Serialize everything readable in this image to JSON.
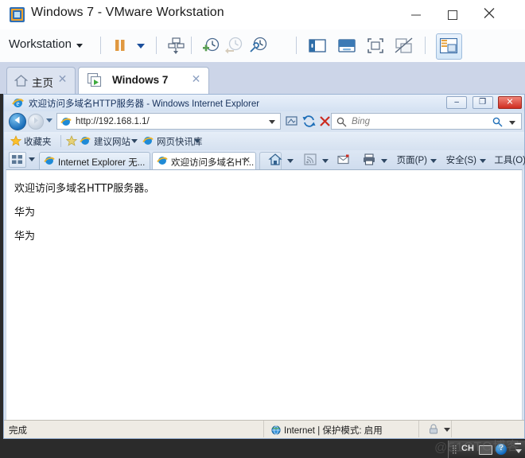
{
  "vmware": {
    "title": "Windows 7 - VMware Workstation",
    "title_icon": "vmware-app-icon",
    "window_controls": {
      "minimize": "—",
      "maximize": "□",
      "close": "✕"
    },
    "toolbar": {
      "menu_label": "Workstation",
      "icons": [
        "pause-vm-icon",
        "pause-dropdown-caret",
        "manage-snapshot-icon",
        "take-snapshot-icon",
        "revert-snapshot-icon",
        "snapshot-manager-icon",
        "show-sidebar-icon",
        "show-console-icon",
        "full-screen-icon",
        "unity-mode-icon",
        "show-thumbnail-bar-icon"
      ]
    },
    "tabs": [
      {
        "label": "主页",
        "icon": "home-icon",
        "close": "✕",
        "active": false
      },
      {
        "label": "Windows 7",
        "icon": "vm-running-icon",
        "close": "✕",
        "active": true
      }
    ]
  },
  "ie": {
    "title": "欢迎访问多域名HTTP服务器 - Windows Internet Explorer",
    "favicon": "ie-logo-icon",
    "window_controls": {
      "minimize": "–",
      "restore": "❐",
      "close": "✕"
    },
    "nav": {
      "back": "back-arrow-icon",
      "forward": "forward-arrow-icon",
      "history_caret": "recent-pages-caret",
      "address_icon": "ie-page-icon",
      "address_value": "http://192.168.1.1/",
      "address_caret": "address-dropdown-caret",
      "compat_view": "compatibility-view-icon",
      "refresh": "refresh-icon",
      "stop": "stop-icon",
      "search_placeholder": "Bing",
      "search_icon": "search-magnifier-icon",
      "search_go": "search-go-icon",
      "search_caret": "search-provider-caret"
    },
    "favorites_bar": [
      {
        "label": "收藏夹",
        "icon": "star-icon"
      },
      {
        "label": "建议网站",
        "icon": "ie-logo-icon",
        "caret": true
      },
      {
        "label": "网页快讯库",
        "icon": "ie-logo-icon",
        "caret": true
      }
    ],
    "favorites_add_icon": "add-to-favorites-icon",
    "tab_row": {
      "quick_tabs_icon": "quick-tabs-icon",
      "tab_list_caret": "tab-list-caret",
      "tabs": [
        {
          "label": "Internet Explorer 无...",
          "icon": "ie-logo-icon",
          "active": false
        },
        {
          "label": "欢迎访问多域名HT...",
          "icon": "ie-logo-icon",
          "active": true,
          "close": "✕"
        }
      ],
      "new_tab": "new-tab-button"
    },
    "command_bar": [
      {
        "label": "",
        "icon": "home-icon",
        "caret": true
      },
      {
        "label": "",
        "icon": "feeds-icon",
        "caret": true
      },
      {
        "label": "",
        "icon": "read-mail-icon",
        "caret": false
      },
      {
        "label": "",
        "icon": "print-icon",
        "caret": true
      },
      {
        "label": "页面(P)",
        "icon": "",
        "caret": true
      },
      {
        "label": "安全(S)",
        "icon": "",
        "caret": true
      },
      {
        "label": "工具(O)",
        "icon": "",
        "caret": true
      },
      {
        "label": "",
        "icon": "help-icon",
        "caret": true
      }
    ],
    "page_content": [
      "欢迎访问多域名HTTP服务器。",
      "华为",
      "华为"
    ],
    "status_bar": {
      "status": "完成",
      "zone_icon": "internet-zone-globe-icon",
      "zone": "Internet | 保护模式: 启用",
      "protected_icon": "protected-mode-lock-icon",
      "zoom_caret": "zoom-level-caret"
    }
  },
  "ime": {
    "grip": "drag-grip-icon",
    "language": "CH",
    "keyboard_icon": "keyboard-icon",
    "help_icon": "ime-help-icon",
    "help_glyph": "?",
    "minimize_icon": "ime-minimize-icon",
    "options_caret": "ime-options-caret"
  },
  "watermark": "@51CTO博客",
  "colors": {
    "vm_tabstrip": "#ccd5e8",
    "ie_chrome": "#d9e4f2",
    "ie_close_red": "#cf2d20",
    "page_bg": "#ffffff",
    "status_bg": "#eeebe4",
    "accent_blue": "#1b6fba"
  }
}
